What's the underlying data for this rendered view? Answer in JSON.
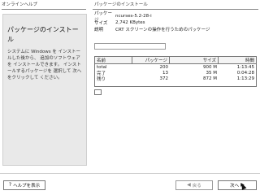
{
  "window": {
    "left_title": "オンラインヘルプ",
    "right_title": "パッケージのインストール"
  },
  "left": {
    "heading": "パッケージのインストール",
    "description": "システムに Windows を インストールした後から、 追加のソフトウェアを インストールできます。 インストールするパッケージを 選択して 次へ をクリックして ください。"
  },
  "info": {
    "rows": [
      {
        "key": "パッケージ",
        "value": "ncurses-5.2-28-i"
      },
      {
        "key": "サイズ",
        "value": "2,742 KBytes"
      },
      {
        "key": "説明",
        "value": "CRT スクリーンの操作を行うためのパッケージ"
      }
    ]
  },
  "search": {
    "value": ""
  },
  "table": {
    "headers": [
      "名前",
      "パッケージ",
      "サイズ",
      "時間"
    ],
    "rows": [
      {
        "name": "total",
        "packages": "200",
        "size": "900 M",
        "time": "1:13:45"
      },
      {
        "name": "完了",
        "packages": "13",
        "size": "35 M",
        "time": "0:04:28"
      },
      {
        "name": "残り",
        "packages": "372",
        "size": "872 M",
        "time": "1:13:29"
      }
    ]
  },
  "buttons": {
    "help": "ヘルプを表示",
    "back": "戻る",
    "next": "次へ"
  }
}
